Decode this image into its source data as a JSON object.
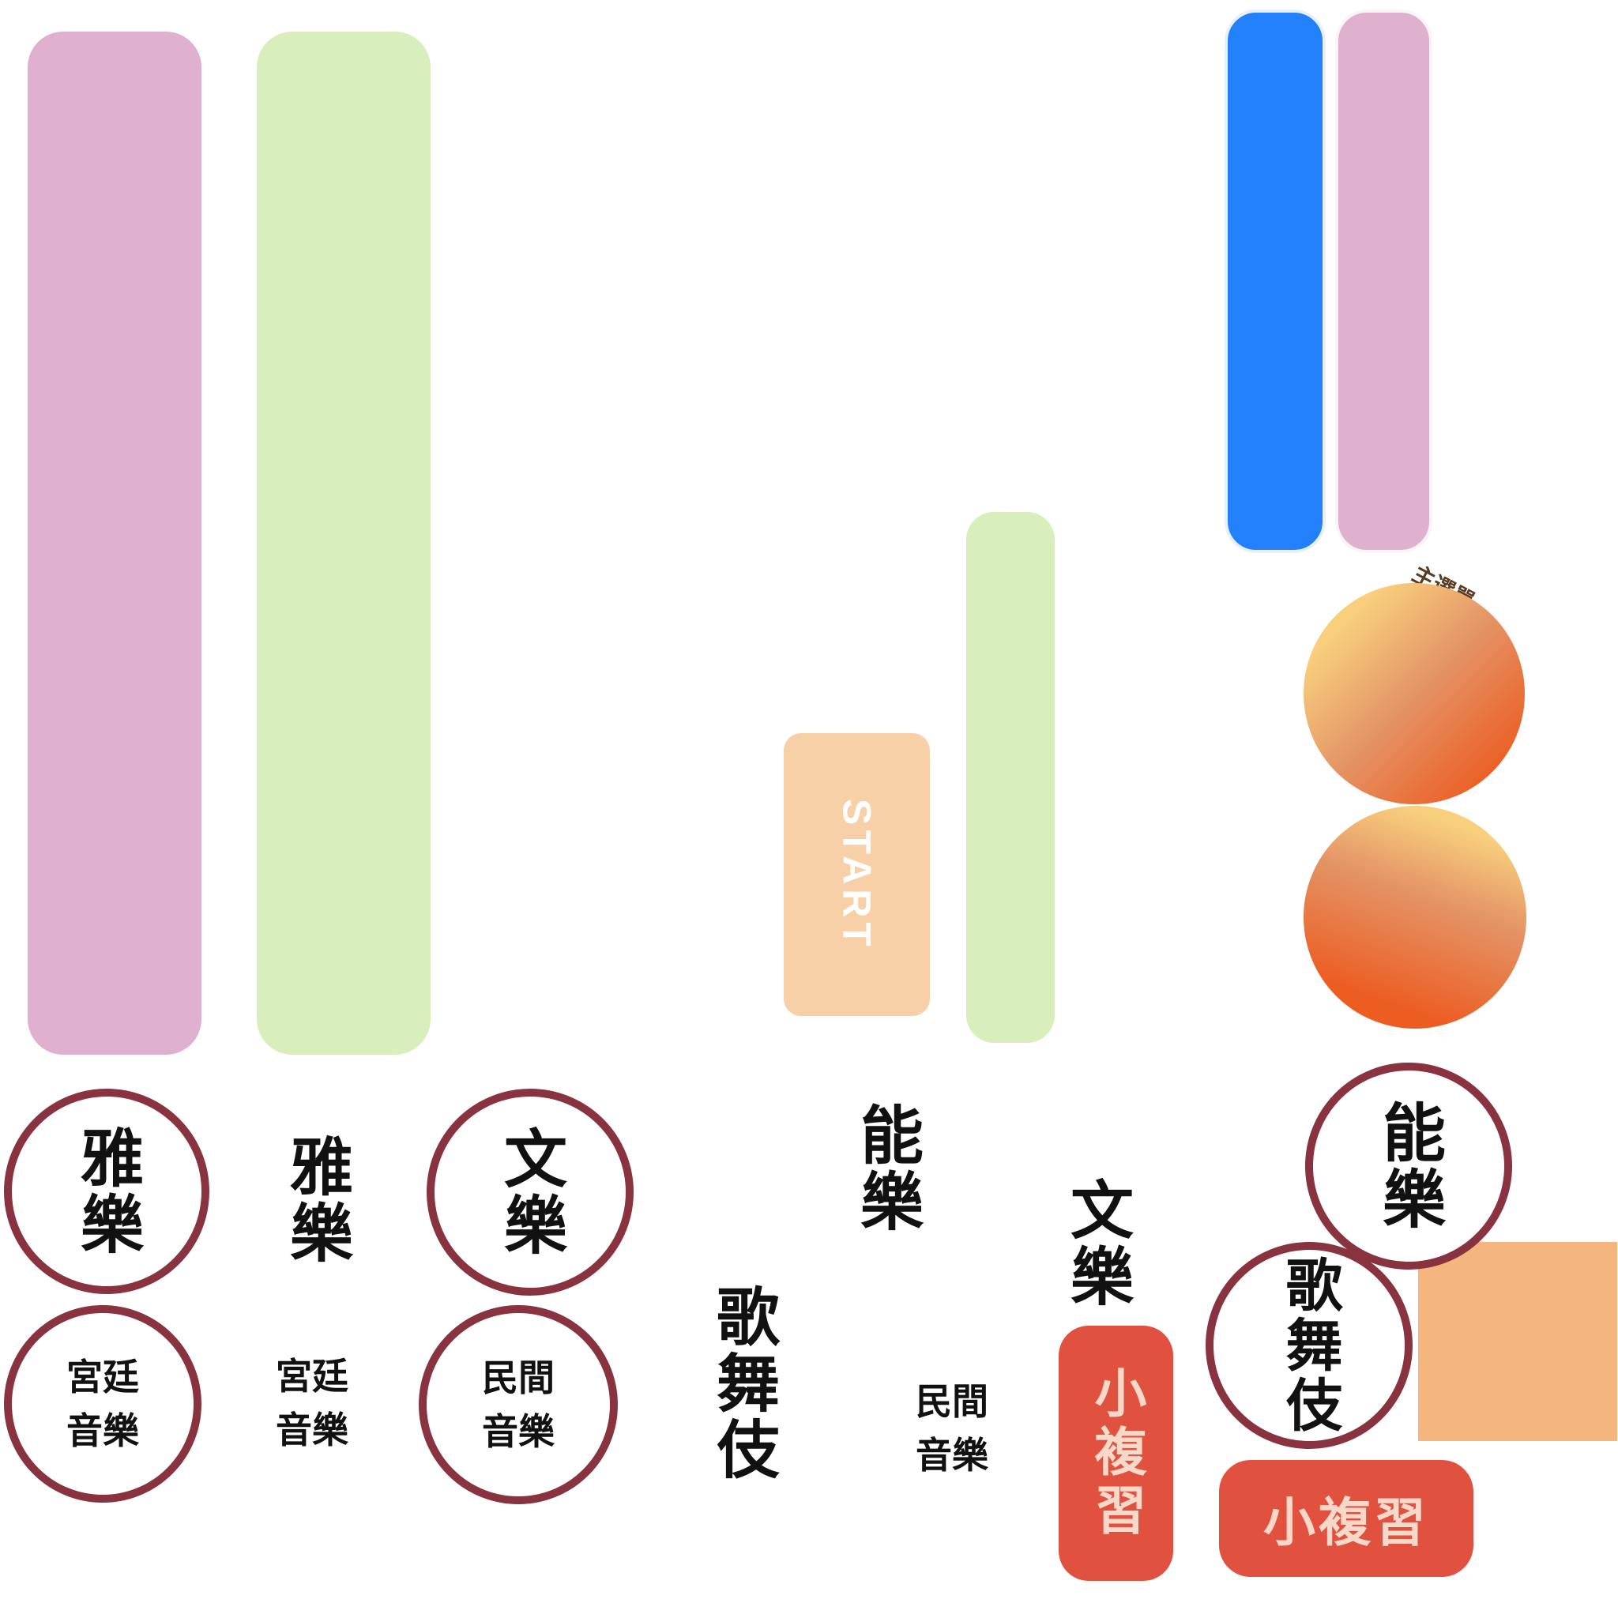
{
  "start_label": "START",
  "main_menu_label": "主選單",
  "review_label": "小複習",
  "genres": {
    "gagaku": "雅樂",
    "bunraku": "文樂",
    "noh": "能樂",
    "kabuki": "歌舞伎"
  },
  "subgenres": {
    "court_line1": "宮廷",
    "court_line2": "音樂",
    "folk_line1": "民間",
    "folk_line2": "音樂"
  },
  "colors": {
    "pink_bar": "#dfb1cf",
    "green_bar": "#d8efbd",
    "blue_bar": "#2280fb",
    "start_button": "#f8d0a8",
    "circle_border": "#8a3340",
    "review_button": "#e15140",
    "orange_square": "#f4b67e",
    "orb_light": "#f8cf7d",
    "orb_dark": "#ec5d22"
  }
}
